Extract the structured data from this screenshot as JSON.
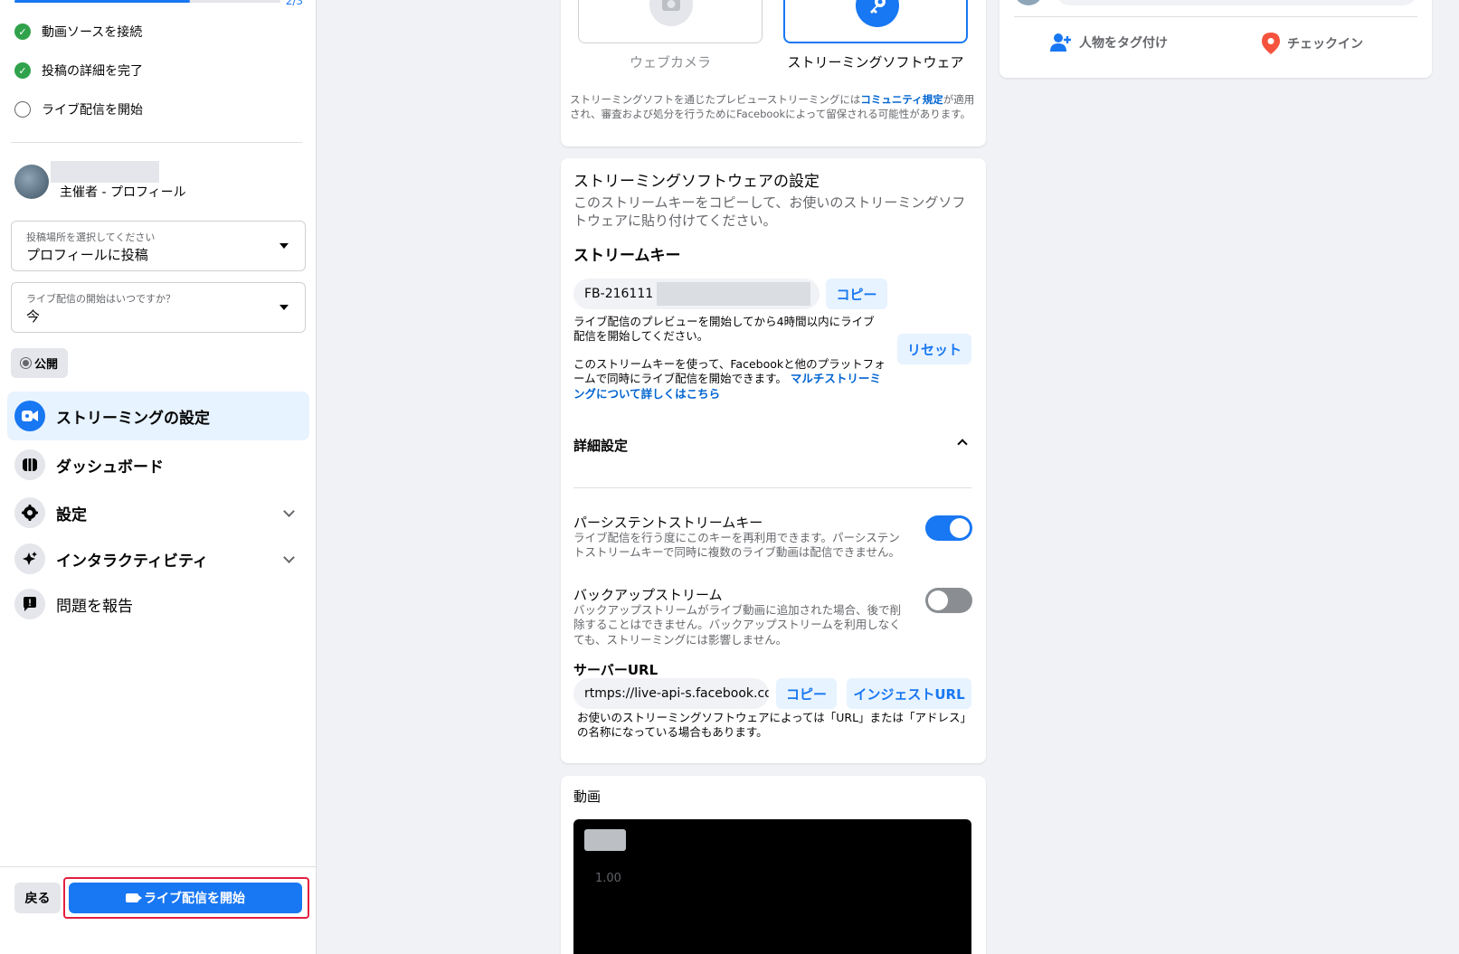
{
  "left": {
    "progress": {
      "label": "2/3",
      "fraction": 0.66
    },
    "steps": [
      {
        "label": "動画ソースを接続",
        "done": true
      },
      {
        "label": "投稿の詳細を完了",
        "done": true
      },
      {
        "label": "ライブ配信を開始",
        "done": false
      }
    ],
    "profile": {
      "role": "主催者 - プロフィール"
    },
    "post_location": {
      "label": "投稿場所を選択してください",
      "value": "プロフィールに投稿"
    },
    "start_time": {
      "label": "ライブ配信の開始はいつですか？",
      "value": "今"
    },
    "privacy": "公開",
    "nav": [
      {
        "label": "ストリーミングの設定",
        "icon": "video-camera-icon",
        "active": true
      },
      {
        "label": "ダッシュボード",
        "icon": "dashboard-icon"
      },
      {
        "label": "設定",
        "icon": "gear-icon",
        "expandable": true
      },
      {
        "label": "インタラクティビティ",
        "icon": "sparkle-icon",
        "expandable": true
      },
      {
        "label": "問題を報告",
        "icon": "report-icon"
      }
    ],
    "back_label": "戻る",
    "go_live_label": "ライブ配信を開始"
  },
  "source": {
    "webcam_label": "ウェブカメラ",
    "software_label": "ストリーミングソフトウェア",
    "note_prefix": "ストリーミングソフトを通じたプレビューストリーミングには",
    "note_link": "コミュニティ規定",
    "note_suffix": "が適用され、審査および処分を行うためにFacebookによって留保される可能性があります。"
  },
  "software": {
    "title": "ストリーミングソフトウェアの設定",
    "desc": "このストリームキーをコピーして、お使いのストリーミングソフトウェアに貼り付けてください。",
    "stream_key_title": "ストリームキー",
    "stream_key_value": "FB-216111",
    "copy_label": "コピー",
    "reset_label": "リセット",
    "key_note": "ライブ配信のプレビューを開始してから4時間以内にライブ配信を開始してください。",
    "multi_note": "このストリームキーを使って、Facebookと他のプラットフォームで同時にライブ配信を開始できます。",
    "multi_link": "マルチストリーミングについて詳しくはこちら",
    "advanced_title": "詳細設定",
    "persistent_title": "パーシステントストリームキー",
    "persistent_desc": "ライブ配信を行う度にこのキーを再利用できます。パーシステントストリームキーで同時に複数のライブ動画は配信できません。",
    "persistent_on": true,
    "backup_title": "バックアップストリーム",
    "backup_desc": "バックアップストリームがライブ動画に追加された場合、後で削除することはできません。バックアップストリームを利用しなくても、ストリーミングには影響しません。",
    "backup_on": false,
    "server_title": "サーバーURL",
    "server_value": "rtmps://live-api-s.facebook.co",
    "server_copy_label": "コピー",
    "ingest_label": "インジェストURL",
    "server_note": "お使いのストリーミングソフトウェアによっては「URL」または「アドレス」の名称になっている場合もあります。"
  },
  "video": {
    "title": "動画",
    "overlay_value": "1.00"
  },
  "right": {
    "tag_label": "人物をタグ付け",
    "checkin_label": "チェックイン"
  },
  "colors": {
    "accent": "#1877f2",
    "success": "#31a24c",
    "danger": "#e41e3f"
  }
}
